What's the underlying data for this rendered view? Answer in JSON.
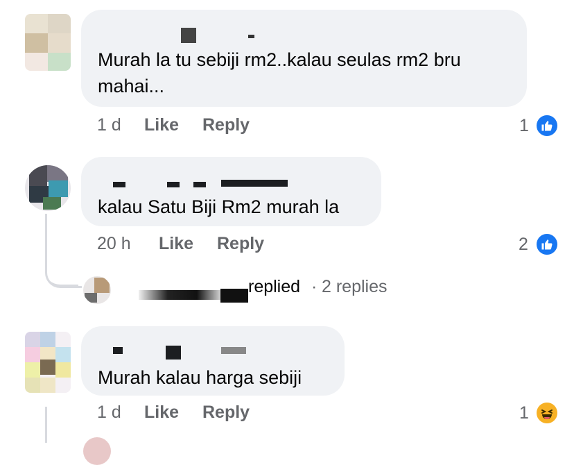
{
  "comments": [
    {
      "text_lines": [
        "Murah la tu sebiji rm2..kalau seulas rm2 bru",
        "mahai..."
      ],
      "time": "1 d",
      "like_label": "Like",
      "reply_label": "Reply",
      "reaction_count": "1",
      "reaction_icon": "like-icon"
    },
    {
      "text_lines": [
        "kalau Satu Biji Rm2 murah la"
      ],
      "time": "20 h",
      "like_label": "Like",
      "reply_label": "Reply",
      "reaction_count": "2",
      "reaction_icon": "like-icon",
      "replies": {
        "replied_label": "replied",
        "separator": "·",
        "count_label": "2 replies"
      }
    },
    {
      "text_lines": [
        "Murah kalau harga sebiji"
      ],
      "time": "1 d",
      "like_label": "Like",
      "reply_label": "Reply",
      "reaction_count": "1",
      "reaction_icon": "haha-icon"
    }
  ],
  "colors": {
    "bubble": "#f0f2f5",
    "meta_text": "#65676b",
    "like_blue": "#1877f2",
    "haha_yellow": "#f7b125"
  }
}
